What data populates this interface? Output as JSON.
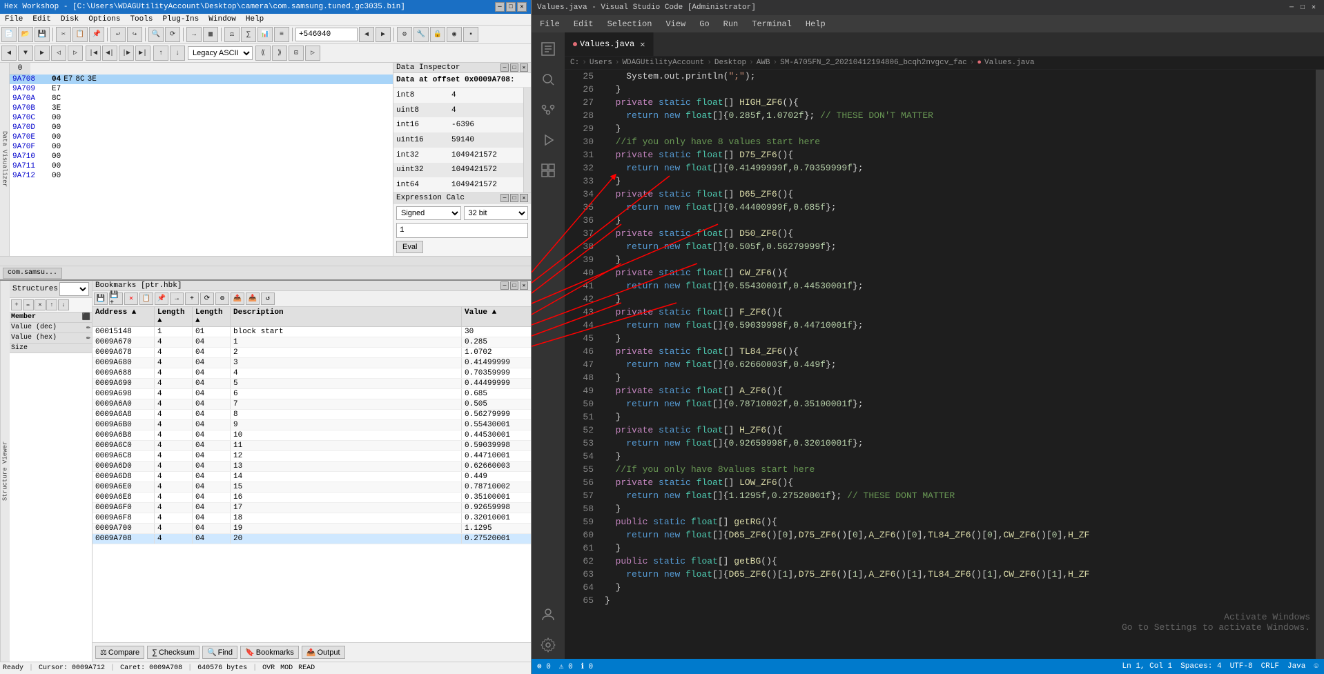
{
  "hexworkshop": {
    "title": "Hex Workshop - [C:\\Users\\WDAGUtilityAccount\\Desktop\\camera\\com.samsung.tuned.gc3035.bin]",
    "menus": [
      "File",
      "Edit",
      "Disk",
      "Options",
      "Tools",
      "Plug-Ins",
      "Window",
      "Help"
    ],
    "offset_value": "+546040",
    "encoding": "Legacy ASCII",
    "data_inspector": {
      "title": "Data Inspector",
      "offset": "Data at offset 0x0009A708:",
      "fields": [
        {
          "label": "int8",
          "value": "4"
        },
        {
          "label": "uint8",
          "value": "4"
        },
        {
          "label": "int16",
          "value": "-6396"
        },
        {
          "label": "uint16",
          "value": "59140"
        },
        {
          "label": "int32",
          "value": "1049421572"
        },
        {
          "label": "uint32",
          "value": "1049421572"
        },
        {
          "label": "int64",
          "value": "1049421572"
        }
      ]
    },
    "expression_calc": {
      "title": "Expression Calc",
      "type": "Signed",
      "bits": "32 bit",
      "value": "1"
    },
    "hex_rows": [
      {
        "addr": "9A708",
        "b0": "04",
        "b1": "E7",
        "b2": "8C",
        "b3": "3E",
        "b4": "00",
        "b5": "00",
        "b6": "00",
        "b7": "00",
        "b8": "00",
        "highlight": true
      },
      {
        "addr": "9A709",
        "b0": "E7"
      },
      {
        "addr": "9A70A",
        "b0": "8C"
      },
      {
        "addr": "9A70B",
        "b0": "3E"
      },
      {
        "addr": "9A70C",
        "b0": "00"
      },
      {
        "addr": "9A70D",
        "b0": "00"
      },
      {
        "addr": "9A70E",
        "b0": "00"
      },
      {
        "addr": "9A70F",
        "b0": "00"
      },
      {
        "addr": "9A710",
        "b0": "00"
      },
      {
        "addr": "9A711",
        "b0": "00"
      },
      {
        "addr": "9A712",
        "b0": "00"
      }
    ],
    "col0": "0",
    "tab_label": "com.samsu...",
    "bookmarks": {
      "title": "Bookmarks [ptr.hbk]",
      "columns": [
        "Address",
        "Length",
        "Length",
        "Description",
        "Value"
      ],
      "rows": [
        {
          "addr": "00015148",
          "len1": "1",
          "len2": "01",
          "desc": "block start",
          "val": "30"
        },
        {
          "addr": "0009A670",
          "len1": "4",
          "len2": "04",
          "desc": "1",
          "val": "0.285"
        },
        {
          "addr": "0009A678",
          "len1": "4",
          "len2": "04",
          "desc": "2",
          "val": "1.0702"
        },
        {
          "addr": "0009A680",
          "len1": "4",
          "len2": "04",
          "desc": "3",
          "val": "0.41499999"
        },
        {
          "addr": "0009A688",
          "len1": "4",
          "len2": "04",
          "desc": "4",
          "val": "0.70359999"
        },
        {
          "addr": "0009A690",
          "len1": "4",
          "len2": "04",
          "desc": "5",
          "val": "0.44499999"
        },
        {
          "addr": "0009A698",
          "len1": "4",
          "len2": "04",
          "desc": "6",
          "val": "0.685"
        },
        {
          "addr": "0009A6A0",
          "len1": "4",
          "len2": "04",
          "desc": "7",
          "val": "0.505"
        },
        {
          "addr": "0009A6A8",
          "len1": "4",
          "len2": "04",
          "desc": "8",
          "val": "0.56279999"
        },
        {
          "addr": "0009A6B0",
          "len1": "4",
          "len2": "04",
          "desc": "9",
          "val": "0.55430001"
        },
        {
          "addr": "0009A6B8",
          "len1": "4",
          "len2": "04",
          "desc": "10",
          "val": "0.44530001"
        },
        {
          "addr": "0009A6C0",
          "len1": "4",
          "len2": "04",
          "desc": "11",
          "val": "0.59039998"
        },
        {
          "addr": "0009A6C8",
          "len1": "4",
          "len2": "04",
          "desc": "12",
          "val": "0.44710001"
        },
        {
          "addr": "0009A6D0",
          "len1": "4",
          "len2": "04",
          "desc": "13",
          "val": "0.62660003"
        },
        {
          "addr": "0009A6D8",
          "len1": "4",
          "len2": "04",
          "desc": "14",
          "val": "0.449"
        },
        {
          "addr": "0009A6E0",
          "len1": "4",
          "len2": "04",
          "desc": "15",
          "val": "0.78710002"
        },
        {
          "addr": "0009A6E8",
          "len1": "4",
          "len2": "04",
          "desc": "16",
          "val": "0.35100001"
        },
        {
          "addr": "0009A6F0",
          "len1": "4",
          "len2": "04",
          "desc": "17",
          "val": "0.92659998"
        },
        {
          "addr": "0009A6F8",
          "len1": "4",
          "len2": "04",
          "desc": "18",
          "val": "0.32010001"
        },
        {
          "addr": "0009A700",
          "len1": "4",
          "len2": "04",
          "desc": "19",
          "val": "1.1295"
        },
        {
          "addr": "0009A708",
          "len1": "4",
          "len2": "04",
          "desc": "20",
          "val": "0.27520001"
        }
      ],
      "bottom_btns": [
        "Compare",
        "Checksum",
        "Find",
        "Bookmarks",
        "Output"
      ]
    },
    "statusbar": {
      "ready": "Ready",
      "cursor": "Cursor: 0009A712",
      "caret": "Caret: 0009A708",
      "size": "640576 bytes",
      "ovr": "OVR",
      "mod": "MOD",
      "read": "READ"
    }
  },
  "vscode": {
    "title": "Values.java - Visual Studio Code [Administrator]",
    "menus": [
      "File",
      "Edit",
      "Selection",
      "View",
      "Go",
      "Run",
      "Terminal",
      "Help"
    ],
    "tab_label": "Values.java",
    "breadcrumb": [
      "C:",
      "Users",
      "WDAGUtilityAccount",
      "Desktop",
      "AWB",
      "SM-A705FN_2_20210412194806_bcqh2nvgcv_fac",
      "Values.java"
    ],
    "lines": [
      {
        "num": 25,
        "code": "    System.out.println(\";\");"
      },
      {
        "num": 26,
        "code": "  }"
      },
      {
        "num": 27,
        "code": "  private static float[] HIGH_ZF6(){"
      },
      {
        "num": 28,
        "code": "    return new float[]{0.285f,1.0702f}; // THESE DON'T MATTER"
      },
      {
        "num": 29,
        "code": "  }"
      },
      {
        "num": 30,
        "code": "  //if you only have 8 values start here"
      },
      {
        "num": 31,
        "code": "  private static float[] D75_ZF6(){"
      },
      {
        "num": 32,
        "code": "    return new float[]{0.41499999f,0.70359999f};"
      },
      {
        "num": 33,
        "code": "  }"
      },
      {
        "num": 34,
        "code": "  private static float[] D65_ZF6(){"
      },
      {
        "num": 35,
        "code": "    return new float[]{0.44400999f,0.685f};"
      },
      {
        "num": 36,
        "code": "  }"
      },
      {
        "num": 37,
        "code": "  private static float[] D50_ZF6(){"
      },
      {
        "num": 38,
        "code": "    return new float[]{0.505f,0.56279999f};"
      },
      {
        "num": 39,
        "code": "  }"
      },
      {
        "num": 40,
        "code": "  private static float[] CW_ZF6(){"
      },
      {
        "num": 41,
        "code": "    return new float[]{0.55430001f,0.44530001f};"
      },
      {
        "num": 42,
        "code": "  }"
      },
      {
        "num": 43,
        "code": "  private static float[] F_ZF6(){"
      },
      {
        "num": 44,
        "code": "    return new float[]{0.59039998f,0.44710001f};"
      },
      {
        "num": 45,
        "code": "  }"
      },
      {
        "num": 46,
        "code": "  private static float[] TL84_ZF6(){"
      },
      {
        "num": 47,
        "code": "    return new float[]{0.62660003f,0.449f};"
      },
      {
        "num": 48,
        "code": "  }"
      },
      {
        "num": 49,
        "code": "  private static float[] A_ZF6(){"
      },
      {
        "num": 50,
        "code": "    return new float[]{0.78710002f,0.35100001f};"
      },
      {
        "num": 51,
        "code": "  }"
      },
      {
        "num": 52,
        "code": "  private static float[] H_ZF6(){"
      },
      {
        "num": 53,
        "code": "    return new float[]{0.92659998f,0.32010001f};"
      },
      {
        "num": 54,
        "code": "  }"
      },
      {
        "num": 55,
        "code": "  //If you only have 8values start here"
      },
      {
        "num": 56,
        "code": "  private static float[] LOW_ZF6(){"
      },
      {
        "num": 57,
        "code": "    return new float[]{1.1295f,0.27520001f}; // THESE DONT MATTER"
      },
      {
        "num": 58,
        "code": "  }"
      },
      {
        "num": 59,
        "code": "  public static float[] getRG(){"
      },
      {
        "num": 60,
        "code": "    return new float[]{D65_ZF6()[0],D75_ZF6()[0],A_ZF6()[0],TL84_ZF6()[0],CW_ZF6()[0],H_ZF"
      },
      {
        "num": 61,
        "code": "  }"
      },
      {
        "num": 62,
        "code": "  public static float[] getBG(){"
      },
      {
        "num": 63,
        "code": "    return new float[]{D65_ZF6()[1],D75_ZF6()[1],A_ZF6()[1],TL84_ZF6()[1],CW_ZF6()[1],H_ZF"
      },
      {
        "num": 64,
        "code": "  }"
      },
      {
        "num": 65,
        "code": "}"
      }
    ],
    "statusbar": {
      "errors": "0",
      "warnings": "0",
      "info": "0",
      "ln": "Ln 1, Col 1",
      "spaces": "Spaces: 4",
      "encoding": "UTF-8",
      "eol": "CRLF",
      "lang": "Java",
      "feedback": "☺"
    },
    "activate": {
      "line1": "Activate Windows",
      "line2": "Go to Settings to activate Windows."
    }
  }
}
